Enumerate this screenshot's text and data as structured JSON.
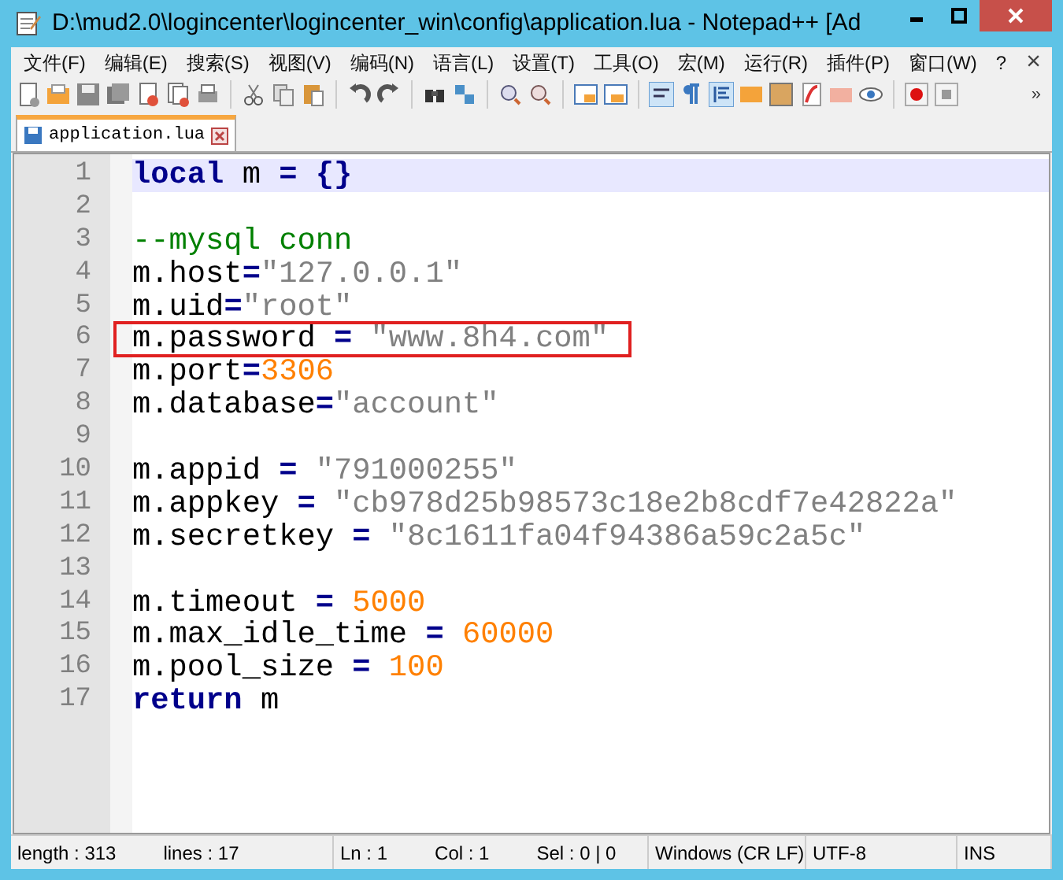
{
  "window": {
    "title": "D:\\mud2.0\\logincenter\\logincenter_win\\config\\application.lua - Notepad++ [Ad"
  },
  "menu": [
    "文件(F)",
    "编辑(E)",
    "搜索(S)",
    "视图(V)",
    "编码(N)",
    "语言(L)",
    "设置(T)",
    "工具(O)",
    "宏(M)",
    "运行(R)",
    "插件(P)",
    "窗口(W)",
    "?"
  ],
  "menu_close": "×",
  "toolbar_more": "»",
  "tabs": [
    {
      "label": "application.lua",
      "selected": true
    }
  ],
  "editor": {
    "lines": [
      {
        "number": "1",
        "highlighted": true,
        "boxed": false,
        "tokens": [
          {
            "kind": "keyword",
            "text": "local"
          },
          {
            "kind": "plain",
            "text": " m "
          },
          {
            "kind": "operator",
            "text": "="
          },
          {
            "kind": "operator",
            "text": " {}"
          }
        ]
      },
      {
        "number": "2",
        "highlighted": false,
        "boxed": false
      },
      {
        "number": "3",
        "highlighted": false,
        "boxed": false,
        "tokens": [
          {
            "kind": "comment",
            "text": "--mysql conn"
          }
        ]
      },
      {
        "number": "4",
        "highlighted": false,
        "boxed": false,
        "tokens": [
          {
            "kind": "plain",
            "text": "m.host"
          },
          {
            "kind": "operator",
            "text": "="
          },
          {
            "kind": "string",
            "text": "\"127.0.0.1\""
          }
        ]
      },
      {
        "number": "5",
        "highlighted": false,
        "boxed": false,
        "tokens": [
          {
            "kind": "plain",
            "text": "m.uid"
          },
          {
            "kind": "operator",
            "text": "="
          },
          {
            "kind": "string",
            "text": "\"root\""
          }
        ]
      },
      {
        "number": "6",
        "highlighted": false,
        "boxed": true,
        "tokens": [
          {
            "kind": "plain",
            "text": "m.password "
          },
          {
            "kind": "operator",
            "text": "="
          },
          {
            "kind": "string",
            "text": " \"www.8h4.com\""
          }
        ]
      },
      {
        "number": "7",
        "highlighted": false,
        "boxed": false,
        "tokens": [
          {
            "kind": "plain",
            "text": "m.port"
          },
          {
            "kind": "operator",
            "text": "="
          },
          {
            "kind": "number",
            "text": "3306"
          }
        ]
      },
      {
        "number": "8",
        "highlighted": false,
        "boxed": false,
        "tokens": [
          {
            "kind": "plain",
            "text": "m.database"
          },
          {
            "kind": "operator",
            "text": "="
          },
          {
            "kind": "string",
            "text": "\"account\""
          }
        ]
      },
      {
        "number": "9",
        "highlighted": false,
        "boxed": false
      },
      {
        "number": "10",
        "highlighted": false,
        "boxed": false,
        "tokens": [
          {
            "kind": "plain",
            "text": "m.appid "
          },
          {
            "kind": "operator",
            "text": "="
          },
          {
            "kind": "string",
            "text": " \"791000255\""
          }
        ]
      },
      {
        "number": "11",
        "highlighted": false,
        "boxed": false,
        "tokens": [
          {
            "kind": "plain",
            "text": "m.appkey "
          },
          {
            "kind": "operator",
            "text": "="
          },
          {
            "kind": "string",
            "text": " \"cb978d25b98573c18e2b8cdf7e42822a\""
          }
        ]
      },
      {
        "number": "12",
        "highlighted": false,
        "boxed": false,
        "tokens": [
          {
            "kind": "plain",
            "text": "m.secretkey "
          },
          {
            "kind": "operator",
            "text": "="
          },
          {
            "kind": "string",
            "text": " \"8c1611fa04f94386a59c2a5c\""
          }
        ]
      },
      {
        "number": "13",
        "highlighted": false,
        "boxed": false
      },
      {
        "number": "14",
        "highlighted": false,
        "boxed": false,
        "tokens": [
          {
            "kind": "plain",
            "text": "m.timeout "
          },
          {
            "kind": "operator",
            "text": "="
          },
          {
            "kind": "number",
            "text": " 5000"
          }
        ]
      },
      {
        "number": "15",
        "highlighted": false,
        "boxed": false,
        "tokens": [
          {
            "kind": "plain",
            "text": "m.max_idle_time "
          },
          {
            "kind": "operator",
            "text": "="
          },
          {
            "kind": "number",
            "text": " 60000"
          }
        ]
      },
      {
        "number": "16",
        "highlighted": false,
        "boxed": false,
        "tokens": [
          {
            "kind": "plain",
            "text": "m.pool_size "
          },
          {
            "kind": "operator",
            "text": "="
          },
          {
            "kind": "number",
            "text": " 100"
          }
        ]
      },
      {
        "number": "17",
        "highlighted": false,
        "boxed": false,
        "tokens": [
          {
            "kind": "keyword",
            "text": "return"
          },
          {
            "kind": "plain",
            "text": " m"
          }
        ]
      }
    ]
  },
  "status_bar": [
    [
      "length : 313",
      "lines : 17"
    ],
    [
      "Ln : 1",
      "Col : 1",
      "Sel : 0 | 0"
    ],
    [
      "Windows (CR LF)"
    ],
    [
      "UTF-8"
    ],
    [
      "INS"
    ]
  ]
}
